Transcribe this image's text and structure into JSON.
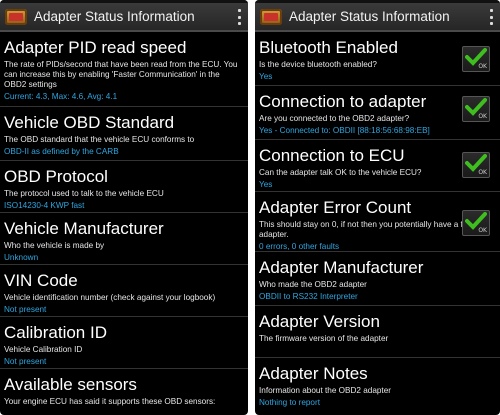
{
  "left": {
    "title": "Adapter Status Information",
    "items": [
      {
        "title": "Adapter PID read speed",
        "desc": "The rate of PIDs/second that have been read from the ECU. You can increase this by enabling 'Faster Communication' in the OBD2 settings",
        "value": "Current: 4.3, Max: 4.6, Avg: 4.1"
      },
      {
        "title": "Vehicle OBD Standard",
        "desc": "The OBD standard that the vehicle ECU conforms to",
        "value": "OBD-II as defined by the CARB"
      },
      {
        "title": "OBD Protocol",
        "desc": "The protocol used to talk to the vehicle ECU",
        "value": "ISO14230-4 KWP fast"
      },
      {
        "title": "Vehicle Manufacturer",
        "desc": "Who the vehicle is made by",
        "value": "Unknown"
      },
      {
        "title": "VIN Code",
        "desc": "Vehicle identification number (check against your logbook)",
        "value": "Not present"
      },
      {
        "title": "Calibration ID",
        "desc": "Vehicle Calibration ID",
        "value": "Not present"
      },
      {
        "title": "Available sensors",
        "desc": "Your engine ECU has said it supports these OBD sensors:",
        "value": ""
      }
    ]
  },
  "right": {
    "title": "Adapter Status Information",
    "items": [
      {
        "title": "Bluetooth Enabled",
        "desc": "Is the device bluetooth enabled?",
        "value": "Yes",
        "checked": true,
        "check_label": "OK"
      },
      {
        "title": "Connection to adapter",
        "desc": "Are you connected to the OBD2 adapter?",
        "value": "Yes - Connected to: OBDII [88:18:56:68:98:EB]",
        "checked": true,
        "check_label": "OK"
      },
      {
        "title": "Connection to ECU",
        "desc": "Can the adapter talk OK to the vehicle ECU?",
        "value": "Yes",
        "checked": true,
        "check_label": "OK"
      },
      {
        "title": "Adapter Error Count",
        "desc": "This should stay on 0, if not then you potentially have a faulty adapter.",
        "value": "0 errors, 0 other faults",
        "checked": true,
        "check_label": "OK"
      },
      {
        "title": "Adapter Manufacturer",
        "desc": "Who made the OBD2 adapter",
        "value": "OBDII to RS232 Interpreter"
      },
      {
        "title": "Adapter Version",
        "desc": "The firmware version of the adapter",
        "value": ""
      },
      {
        "title": "Adapter Notes",
        "desc": "Information about the OBD2 adapter",
        "value": "Nothing to report"
      }
    ]
  },
  "colors": {
    "value_blue": "#2fa6e0",
    "check_green": "#3fbf1f",
    "background": "#000000"
  }
}
